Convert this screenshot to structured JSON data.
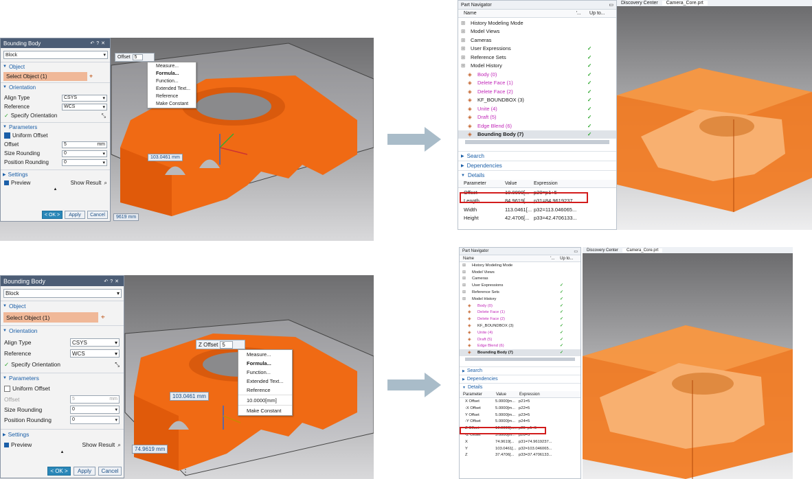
{
  "top": {
    "dialog": {
      "title": "Bounding Body",
      "type": "Block",
      "object_section": "Object",
      "select_object": "Select Object (1)",
      "orientation_section": "Orientation",
      "align_type_label": "Align Type",
      "align_type_value": "CSYS",
      "reference_label": "Reference",
      "reference_value": "WCS",
      "specify_orientation": "Specify Orientation",
      "parameters_section": "Parameters",
      "uniform_offset": "Uniform Offset",
      "offset_label": "Offset",
      "offset_value": "5",
      "offset_unit": "mm",
      "size_rounding_label": "Size Rounding",
      "size_rounding_value": "0",
      "position_rounding_label": "Position Rounding",
      "position_rounding_value": "0",
      "settings_section": "Settings",
      "preview": "Preview",
      "show_result": "Show Result",
      "ok": "< OK >",
      "apply": "Apply",
      "cancel": "Cancel"
    },
    "offset_field": {
      "label": "Offset",
      "value": "5"
    },
    "menu": [
      "Measure...",
      "Formula...",
      "Function...",
      "Extended Text...",
      "Reference",
      "Make Constant"
    ],
    "dim1": "103.0461 mm",
    "dim2": "9619 mm",
    "navigator": {
      "title": "Part Navigator",
      "col_name": "Name",
      "col_2": "'...",
      "col_3": "Up to...",
      "rows": [
        {
          "label": "History Modeling Mode",
          "type": "plain"
        },
        {
          "label": "Model Views",
          "type": "plain"
        },
        {
          "label": "Cameras",
          "type": "plain"
        },
        {
          "label": "User Expressions",
          "type": "plain"
        },
        {
          "label": "Reference Sets",
          "type": "plain"
        },
        {
          "label": "Model History",
          "type": "plain"
        },
        {
          "label": "Body (0)",
          "type": "pink"
        },
        {
          "label": "Delete Face (1)",
          "type": "pink"
        },
        {
          "label": "Delete Face (2)",
          "type": "pink"
        },
        {
          "label": "KF_BOUNDBOX (3)",
          "type": "plain"
        },
        {
          "label": "Unite (4)",
          "type": "pink"
        },
        {
          "label": "Draft (5)",
          "type": "pink"
        },
        {
          "label": "Edge Blend (6)",
          "type": "pink"
        },
        {
          "label": "Bounding Body (7)",
          "type": "bold"
        }
      ],
      "search": "Search",
      "dependencies": "Dependencies",
      "details": "Details",
      "details_cols": [
        "Parameter",
        "Value",
        "Expression"
      ],
      "details_rows": [
        {
          "p": "Offset",
          "v": "10.0000[...",
          "e": "p20=p1+5"
        },
        {
          "p": "Length",
          "v": "84.9619[...",
          "e": "p31=84.9619237..."
        },
        {
          "p": "Width",
          "v": "113.0461[...",
          "e": "p32=113.046065..."
        },
        {
          "p": "Height",
          "v": "42.4706[...",
          "e": "p33=42.4706133..."
        }
      ]
    },
    "tabs": [
      "Discovery Center",
      "Camera_Core.prt"
    ]
  },
  "bottom": {
    "dialog": {
      "title": "Bounding Body",
      "type": "Block",
      "object_section": "Object",
      "select_object": "Select Object (1)",
      "orientation_section": "Orientation",
      "align_type_label": "Align Type",
      "align_type_value": "CSYS",
      "reference_label": "Reference",
      "reference_value": "WCS",
      "specify_orientation": "Specify Orientation",
      "parameters_section": "Parameters",
      "uniform_offset": "Uniform Offset",
      "offset_label": "Offset",
      "offset_value": "5",
      "offset_unit": "mm",
      "size_rounding_label": "Size Rounding",
      "size_rounding_value": "0",
      "position_rounding_label": "Position Rounding",
      "position_rounding_value": "0",
      "settings_section": "Settings",
      "preview": "Preview",
      "show_result": "Show Result",
      "ok": "< OK >",
      "apply": "Apply",
      "cancel": "Cancel"
    },
    "offset_field": {
      "label": "Z Offset",
      "value": "5"
    },
    "menu": [
      "Measure...",
      "Formula...",
      "Function...",
      "Extended Text...",
      "Reference",
      "10.0000[mm]",
      "Make Constant"
    ],
    "dim1": "103.0461 mm",
    "dim2": "74.9619 mm",
    "navigator": {
      "title": "Part Navigator",
      "col_name": "Name",
      "col_2": "'...",
      "col_3": "Up to...",
      "rows": [
        {
          "label": "History Modeling Mode",
          "type": "plain"
        },
        {
          "label": "Model Views",
          "type": "plain"
        },
        {
          "label": "Cameras",
          "type": "plain"
        },
        {
          "label": "User Expressions",
          "type": "plain"
        },
        {
          "label": "Reference Sets",
          "type": "plain"
        },
        {
          "label": "Model History",
          "type": "plain"
        },
        {
          "label": "Body (0)",
          "type": "pink"
        },
        {
          "label": "Delete Face (1)",
          "type": "pink"
        },
        {
          "label": "Delete Face (2)",
          "type": "pink"
        },
        {
          "label": "KF_BOUNDBOX (3)",
          "type": "plain"
        },
        {
          "label": "Unite (4)",
          "type": "pink"
        },
        {
          "label": "Draft (5)",
          "type": "pink"
        },
        {
          "label": "Edge Blend (6)",
          "type": "pink"
        },
        {
          "label": "Bounding Body (7)",
          "type": "bold"
        }
      ],
      "search": "Search",
      "dependencies": "Dependencies",
      "details": "Details",
      "details_cols": [
        "Parameter",
        "Value",
        "Expression"
      ],
      "details_rows": [
        {
          "p": "X Offset",
          "v": "5.0000[m...",
          "e": "p21=5"
        },
        {
          "p": "-X Offset",
          "v": "5.0000[m...",
          "e": "p22=5"
        },
        {
          "p": "Y Offset",
          "v": "5.0000[m...",
          "e": "p23=5"
        },
        {
          "p": "-Y Offset",
          "v": "5.0000[m...",
          "e": "p24=5"
        },
        {
          "p": "Z Offset",
          "v": "10.0000[m...",
          "e": "p25=p1+5"
        },
        {
          "p": "-Z Offset",
          "v": "5.0000[m...",
          "e": "p26=5"
        },
        {
          "p": "X",
          "v": "74.9619[...",
          "e": "p31=74.9619237..."
        },
        {
          "p": "Y",
          "v": "103.0461[...",
          "e": "p32=103.046065..."
        },
        {
          "p": "Z",
          "v": "37.4706[...",
          "e": "p33=37.4706133..."
        }
      ]
    },
    "tabs": [
      "Discovery Center",
      "Camera_Core.prt"
    ]
  },
  "colors": {
    "accent": "#1b5fa8",
    "orange": "#f06a14",
    "highlight": "#d21b1b",
    "titlebar": "#4c5d75"
  }
}
